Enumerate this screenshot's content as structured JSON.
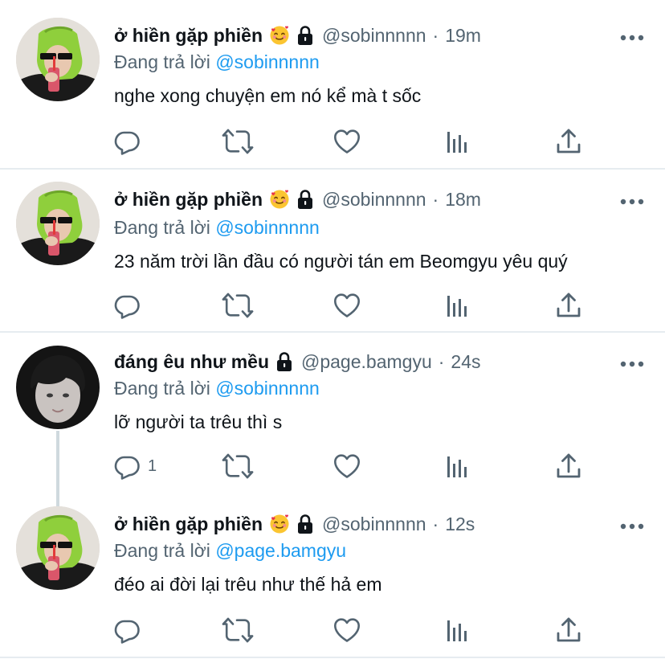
{
  "tweets": [
    {
      "display_name": "ở hiền gặp phiền",
      "emoji": "smiling-face-with-hearts-icon",
      "handle": "@sobinnnnn",
      "time": "19m",
      "reply_prefix": "Đang trả lời",
      "reply_to": "@sobinnnnn",
      "text": "nghe xong chuyện em nó kể mà t sốc",
      "reply_count": ""
    },
    {
      "display_name": "ở hiền gặp phiền",
      "emoji": "smiling-face-with-hearts-icon",
      "handle": "@sobinnnnn",
      "time": "18m",
      "reply_prefix": "Đang trả lời",
      "reply_to": "@sobinnnnn",
      "text": "23 năm trời lần đầu có người tán em Beomgyu yêu quý",
      "reply_count": ""
    },
    {
      "display_name": "đáng êu như mều",
      "emoji": "",
      "handle": "@page.bamgyu",
      "time": "24s",
      "reply_prefix": "Đang trả lời",
      "reply_to": "@sobinnnnn",
      "text": "lỡ người ta trêu thì s",
      "reply_count": "1"
    },
    {
      "display_name": "ở hiền gặp phiền",
      "emoji": "smiling-face-with-hearts-icon",
      "handle": "@sobinnnnn",
      "time": "12s",
      "reply_prefix": "Đang trả lời",
      "reply_to": "@page.bamgyu",
      "text": "đéo ai đời lại trêu như thế hả em",
      "reply_count": ""
    }
  ],
  "separator": "·",
  "colors": {
    "accent": "#1d9bf0",
    "secondary_text": "#536471",
    "primary_text": "#0f1419",
    "divider": "#e6ecf0",
    "avatar_green": "#8fcf3c"
  }
}
